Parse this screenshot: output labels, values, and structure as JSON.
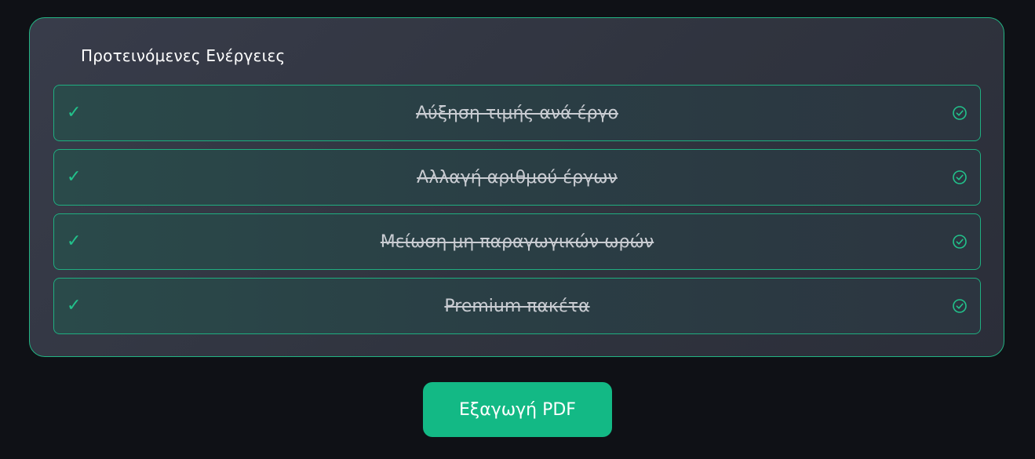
{
  "panel": {
    "title": "Προτεινόμενες Ενέργειες",
    "items": [
      {
        "label": "Αύξηση τιμής ανά έργο",
        "icon": "check-mark-icon",
        "status_icon": "check-circle-icon",
        "completed": true
      },
      {
        "label": "Αλλαγή αριθμού έργων",
        "icon": "check-mark-icon",
        "status_icon": "check-circle-icon",
        "completed": true
      },
      {
        "label": "Μείωση μη παραγωγικών ωρών",
        "icon": "check-mark-icon",
        "status_icon": "check-circle-icon",
        "completed": true
      },
      {
        "label": "Premium πακέτα",
        "icon": "check-mark-icon",
        "status_icon": "check-circle-icon",
        "completed": true
      }
    ]
  },
  "export": {
    "label": "Εξαγωγή PDF"
  },
  "colors": {
    "accent": "#13b985",
    "border": "#22b483",
    "background": "#0f1116"
  }
}
